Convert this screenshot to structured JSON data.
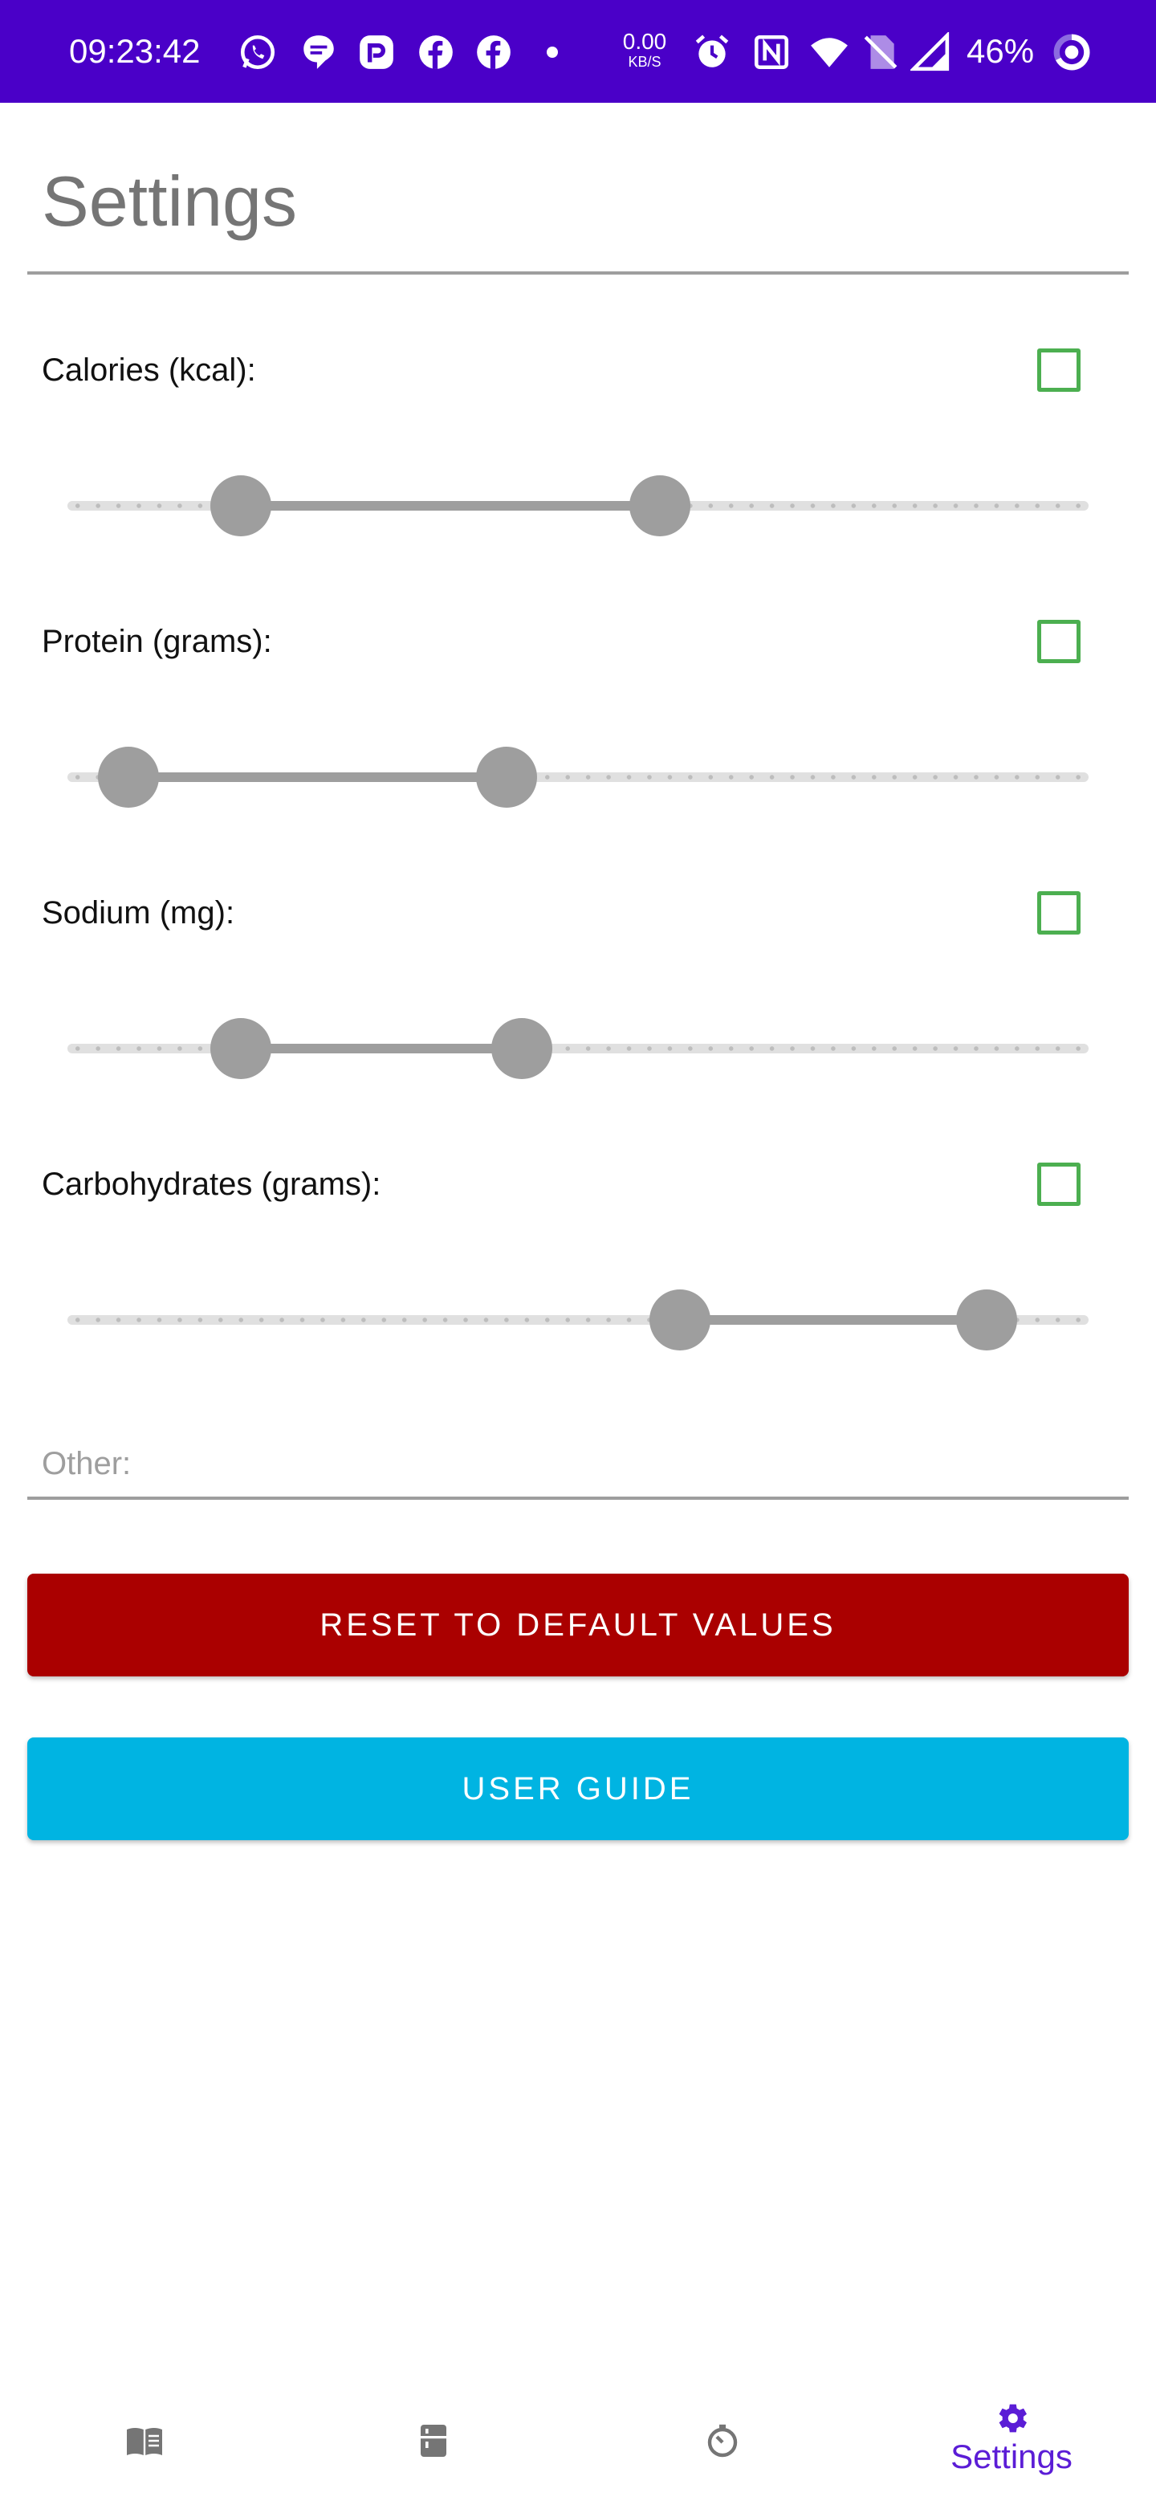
{
  "status_bar": {
    "time": "09:23:42",
    "net_speed_value": "0.00",
    "net_speed_unit": "KB/S",
    "battery": "46%",
    "icons": [
      "whatsapp-icon",
      "messages-icon",
      "reddit-icon",
      "facebook-icon",
      "facebook-icon",
      "notification-dot",
      "alarm-icon",
      "nfc-icon",
      "wifi-icon",
      "no-sim-icon",
      "cell-signal-icon",
      "battery-ring-icon"
    ],
    "color": "#4a00c8"
  },
  "page": {
    "title": "Settings"
  },
  "nutrients": [
    {
      "label": "Calories (kcal):",
      "checked": false,
      "range_low": 0.17,
      "range_high": 0.58
    },
    {
      "label": "Protein (grams):",
      "checked": false,
      "range_low": 0.06,
      "range_high": 0.43
    },
    {
      "label": "Sodium (mg):",
      "checked": false,
      "range_low": 0.17,
      "range_high": 0.445
    },
    {
      "label": "Carbohydrates (grams):",
      "checked": false,
      "range_low": 0.6,
      "range_high": 0.9
    }
  ],
  "other": {
    "label": "Other:"
  },
  "buttons": {
    "reset_label": "RESET TO DEFAULT VALUES",
    "reset_color": "#aa0000",
    "guide_label": "USER GUIDE",
    "guide_color": "#00b4e2"
  },
  "bottom_nav": {
    "items": [
      {
        "icon": "book-icon",
        "label": ""
      },
      {
        "icon": "fridge-icon",
        "label": ""
      },
      {
        "icon": "timer-icon",
        "label": ""
      },
      {
        "icon": "gear-icon",
        "label": "Settings",
        "active": true
      }
    ],
    "active_color": "#5b1dd6",
    "inactive_color": "#757575"
  },
  "colors": {
    "checkbox_border": "#4caf50",
    "slider": "#9e9e9e"
  }
}
